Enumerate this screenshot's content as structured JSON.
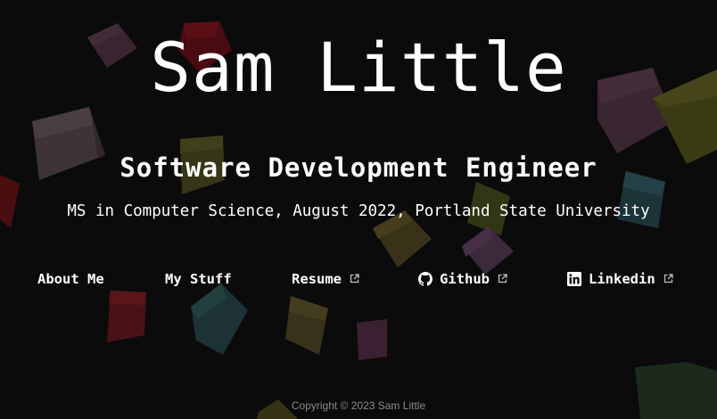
{
  "hero": {
    "name": "Sam Little",
    "title": "Software Development Engineer",
    "education": "MS in Computer Science, August 2022, Portland State University"
  },
  "nav": {
    "about": {
      "label": "About Me",
      "icon": null,
      "external": false
    },
    "stuff": {
      "label": "My Stuff",
      "icon": null,
      "external": false
    },
    "resume": {
      "label": "Resume",
      "icon": "external-link-icon",
      "external": true
    },
    "github": {
      "label": "Github",
      "icon": "github-icon",
      "external": true
    },
    "linkedin": {
      "label": "Linkedin",
      "icon": "linkedin-icon",
      "external": true
    }
  },
  "footer": {
    "copyright": "Copyright © 2023 Sam Little"
  },
  "colors": {
    "background": "#0b0b0b",
    "text": "#ffffff",
    "footer_text": "#8a8a8a",
    "cube_palette": [
      "#4a2c3a",
      "#5a0d12",
      "#47463c",
      "#3a3a14",
      "#1e3a3f",
      "#4a2f4a",
      "#41381a",
      "#52131a",
      "#1f3324",
      "#3e3a16"
    ]
  }
}
